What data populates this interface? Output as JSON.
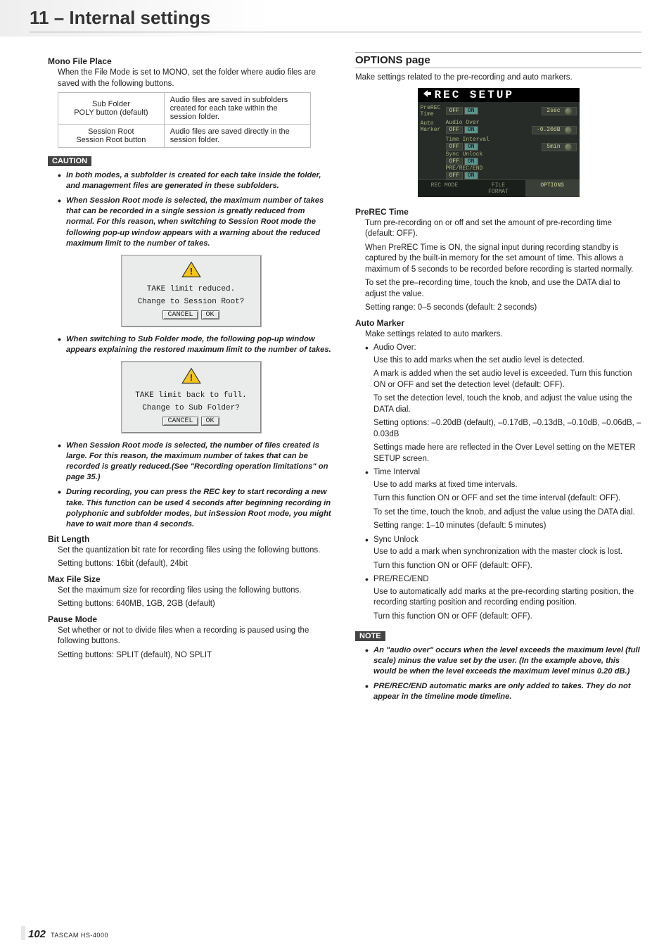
{
  "header": {
    "title": "11 – Internal settings"
  },
  "left": {
    "mono": {
      "heading": "Mono File Place",
      "intro": "When the File Mode is set to MONO, set the folder where audio files are saved with the following buttons.",
      "table": {
        "r1c1a": "Sub Folder",
        "r1c1b": "POLY button (default)",
        "r1c2": "Audio files are saved in subfolders created for each take within the session folder.",
        "r2c1a": "Session Root",
        "r2c1b": "Session Root button",
        "r2c2": "Audio files are saved directly in the session folder."
      }
    },
    "caution_label": "CAUTION",
    "caution_items": [
      "In both modes, a subfolder is created for each take inside the folder, and management files are generated in these subfolders.",
      "When Session Root mode is selected, the maximum number of takes that can be recorded in a single session is greatly reduced from normal. For this reason, when switching to Session Root mode the following pop-up window appears with a warning about the reduced maximum limit to the number of takes."
    ],
    "popup1": {
      "line1": "TAKE limit reduced.",
      "line2": "Change to Session Root?",
      "cancel": "CANCEL",
      "ok": "OK"
    },
    "caution_mid": "When switching to Sub Folder mode, the following pop-up window appears explaining the restored maximum limit to the number of takes.",
    "popup2": {
      "line1": "TAKE limit back to full.",
      "line2": "Change to Sub Folder?",
      "cancel": "CANCEL",
      "ok": "OK"
    },
    "caution_after": [
      "When Session Root mode is selected, the number of files created is large. For this reason, the maximum number of takes that can be recorded is greatly reduced.(See \"Recording operation limitations\" on page 35.)",
      "During recording, you can press the REC key to start recording a new take. This function can be used 4 seconds after beginning recording in polyphonic and subfolder modes, but inSession Root mode, you might have to wait more than 4 seconds."
    ],
    "bitlen": {
      "heading": "Bit Length",
      "p1": "Set the quantization bit rate for recording files using the following buttons.",
      "p2": "Setting buttons: 16bit (default), 24bit"
    },
    "maxfile": {
      "heading": "Max File Size",
      "p1": "Set the maximum size for recording files using the following buttons.",
      "p2": "Setting buttons: 640MB, 1GB, 2GB (default)"
    },
    "pause": {
      "heading": "Pause Mode",
      "p1": "Set whether or not to divide files when a recording is paused using the following buttons.",
      "p2": "Setting buttons: SPLIT (default), NO SPLIT"
    }
  },
  "right": {
    "options_heading": "OPTIONS page",
    "intro": "Make settings related to the pre-recording and auto markers.",
    "lcd": {
      "title": "REC SETUP",
      "prerec_lbl": "PreREC\nTime",
      "off": "OFF",
      "on": "ON",
      "val_2sec": "2sec",
      "auto_lbl": "Auto\nMarker",
      "audio_over": "Audio Over",
      "val_m020": "-0.20dB",
      "time_interval": "Time Interval",
      "val_5min": "5min",
      "sync_unlock": "Sync Unlock",
      "pre_rec_end": "PRE/REC/END",
      "tab_rec": "REC MODE",
      "tab_file": "FILE\nFORMAT",
      "tab_options": "OPTIONS"
    },
    "prerec": {
      "heading": "PreREC Time",
      "p1": "Turn pre-recording on or off and set the amount of pre-recording time (default: OFF).",
      "p2": "When PreREC Time is ON, the signal input during recording standby is captured by the built-in memory for the set amount of time. This allows a maximum of 5 seconds to be recorded before recording is started normally.",
      "p3": "To set the pre–recording time, touch the knob, and use the DATA dial to adjust the value.",
      "p4": "Setting range: 0–5 seconds (default: 2 seconds)"
    },
    "automarker": {
      "heading": "Auto Marker",
      "intro": "Make settings related to auto markers.",
      "items": [
        {
          "label": "Audio Over:",
          "lines": [
            "Use this to add marks when the set audio level is detected.",
            "A mark is added when the set audio level is exceeded. Turn this function ON or OFF and set the detection level (default: OFF).",
            "To set the detection level, touch the knob, and adjust the value using the DATA dial.",
            "Setting options: –0.20dB (default), –0.17dB, –0.13dB, –0.10dB, –0.06dB, –0.03dB",
            "Settings made here are reflected in the Over Level setting on the METER SETUP screen."
          ]
        },
        {
          "label": "Time Interval",
          "lines": [
            "Use to add marks at fixed time intervals.",
            "Turn this function ON or OFF and set the time interval (default: OFF).",
            "To set the time, touch the knob, and adjust the value using the DATA dial.",
            "Setting range: 1–10 minutes (default: 5 minutes)"
          ]
        },
        {
          "label": "Sync Unlock",
          "lines": [
            "Use to add a mark when synchronization with the master clock is lost.",
            "Turn this function ON or OFF (default: OFF)."
          ]
        },
        {
          "label": "PRE/REC/END",
          "lines": [
            "Use to automatically add marks at the pre-recording starting position, the recording starting position and recording ending position.",
            "Turn this function ON or OFF (default: OFF)."
          ]
        }
      ]
    },
    "note_label": "NOTE",
    "note_items": [
      "An \"audio over\" occurs when the level exceeds the maximum level (full scale) minus the value set by the user. (In the example above, this would be when the level exceeds the maximum level minus 0.20 dB.)",
      "PRE/REC/END automatic marks are only added to takes. They do not appear in the timeline mode timeline."
    ]
  },
  "footer": {
    "page": "102",
    "brand": "TASCAM HS-4000"
  }
}
